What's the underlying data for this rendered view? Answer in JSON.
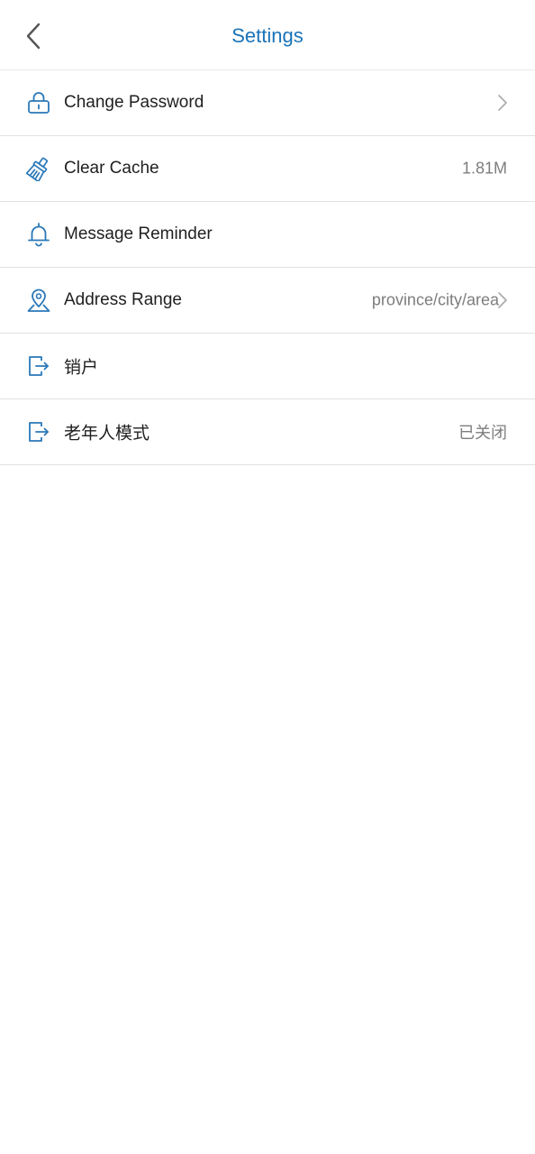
{
  "header": {
    "title": "Settings",
    "back_icon": "chevron-left-icon"
  },
  "colors": {
    "accent": "#1a73b8",
    "icon": "#2a78b8",
    "label": "#1f1f1f",
    "value": "#7d7d7d",
    "divider": "#e2e2e2"
  },
  "settings": {
    "items": [
      {
        "icon": "lock-icon",
        "label": "Change Password",
        "value": "",
        "chevron": true
      },
      {
        "icon": "broom-icon",
        "label": "Clear Cache",
        "value": "1.81M",
        "chevron": false
      },
      {
        "icon": "bell-icon",
        "label": "Message Reminder",
        "value": "",
        "chevron": false
      },
      {
        "icon": "map-pin-icon",
        "label": "Address Range",
        "value": "province/city/area",
        "chevron": true
      },
      {
        "icon": "logout-icon",
        "label": "销户",
        "value": "",
        "chevron": false
      },
      {
        "icon": "logout-icon",
        "label": "老年人模式",
        "value": "已关闭",
        "chevron": false
      }
    ]
  }
}
